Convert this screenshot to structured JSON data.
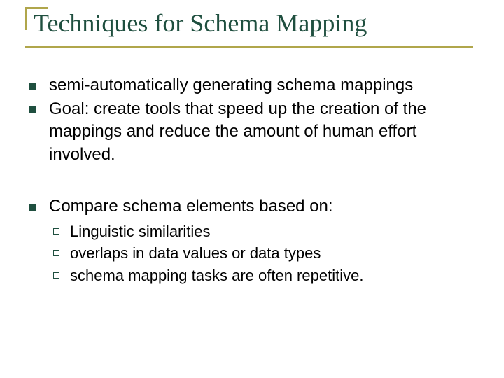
{
  "title": "Techniques for Schema Mapping",
  "bullets": {
    "b1": "semi-automatically generating schema mappings",
    "b2": "Goal: create tools that speed up the creation of the mappings and reduce the amount of human effort involved.",
    "b3": "Compare schema elements based on:",
    "sub": {
      "s1": "Linguistic similarities",
      "s2": "overlaps in data values or data types",
      "s3": "schema mapping tasks are often repetitive."
    }
  }
}
